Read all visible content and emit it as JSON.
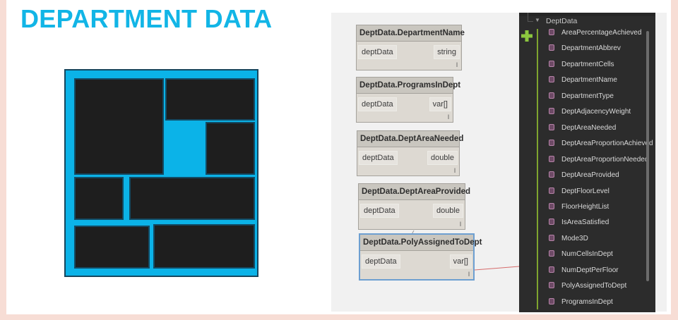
{
  "slide": {
    "title": "DEPARTMENT DATA"
  },
  "colors": {
    "accent": "#12b5e6",
    "diagram_fill": "#0bb3e8",
    "block": "#1e1e1e",
    "library_bg": "#2c2c2c"
  },
  "nodes": [
    {
      "title": "DeptData.DepartmentName",
      "input": "deptData",
      "output": "string",
      "lacing": "l"
    },
    {
      "title": "DeptData.ProgramsInDept",
      "input": "deptData",
      "output": "var[]",
      "lacing": "l"
    },
    {
      "title": "DeptData.DeptAreaNeeded",
      "input": "deptData",
      "output": "double",
      "lacing": "l"
    },
    {
      "title": "DeptData.DeptAreaProvided",
      "input": "deptData",
      "output": "double",
      "lacing": "l"
    },
    {
      "title": "DeptData.PolyAssignedToDept",
      "input": "deptData",
      "output": "var[]",
      "lacing": "l"
    }
  ],
  "library": {
    "header": "DeptData",
    "add_icon": "plus-icon",
    "items": [
      "AreaPercentageAchieved",
      "DepartmentAbbrev",
      "DepartmentCells",
      "DepartmentName",
      "DepartmentType",
      "DeptAdjacencyWeight",
      "DeptAreaNeeded",
      "DeptAreaProportionAchieved",
      "DeptAreaProportionNeeded",
      "DeptAreaProvided",
      "DeptFloorLevel",
      "FloorHeightList",
      "IsAreaSatisfied",
      "Mode3D",
      "NumCellsInDept",
      "NumDeptPerFloor",
      "PolyAssignedToDept",
      "ProgramsInDept"
    ]
  }
}
